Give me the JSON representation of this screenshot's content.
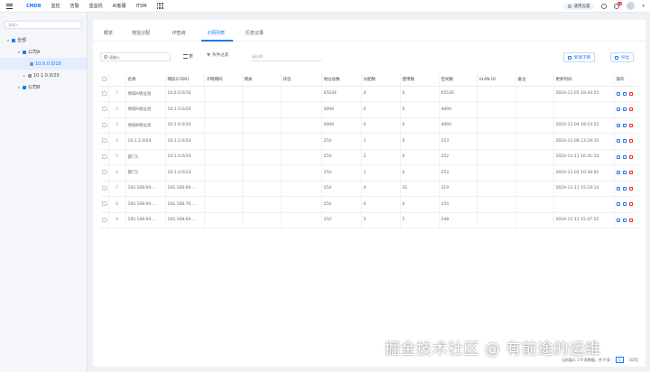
{
  "topnav": {
    "items": [
      "CMDB",
      "监控",
      "告警",
      "堡垒机",
      "AI客服",
      "ITSM"
    ],
    "active_index": 0,
    "help_label": "通用设置",
    "badge_count": "99"
  },
  "sidebar": {
    "search_placeholder": "请输入",
    "tree": [
      {
        "label": "全部",
        "level": 0
      },
      {
        "label": "公司A",
        "level": 1
      },
      {
        "label": "10.0.0.0/16",
        "level": 2,
        "selected": true
      },
      {
        "label": "10.1.0.0/20",
        "level": 2
      },
      {
        "label": "公司B",
        "level": 1
      }
    ]
  },
  "tabs": [
    "概览",
    "地址分配",
    "IP查询",
    "子网列表",
    "历史记录"
  ],
  "active_tab": 3,
  "toolbar": {
    "search_placeholder": "请输入",
    "view_label": "表",
    "filter_label": "条件过滤",
    "filter_placeholder": "请选择",
    "create_label": "新建子网",
    "export_label": "导出"
  },
  "table": {
    "columns": [
      "",
      "",
      "名称",
      "网段(CIDR)",
      "子网掩码",
      "网关",
      "状态",
      "地址总数",
      "分配数",
      "使用数",
      "空闲数",
      "VLAN ID",
      "备注",
      "更新时间",
      "操作"
    ],
    "rows": [
      [
        "1",
        "地域A地址池",
        "10.0.0.0/16",
        "",
        "",
        "",
        "65534",
        "4",
        "0",
        "65530",
        "",
        "",
        "2024-11-05 18:44:55"
      ],
      [
        "2",
        "地域A地址池",
        "10.1.0.0/20",
        "",
        "",
        "",
        "4094",
        "0",
        "0",
        "4094",
        "",
        "",
        ""
      ],
      [
        "3",
        "地域B地址池",
        "10.2.0.0/20",
        "",
        "",
        "",
        "4094",
        "0",
        "0",
        "4094",
        "",
        "",
        "2024-11-04 18:14:25"
      ],
      [
        "4",
        "10.1.2.0/24",
        "10.1.2.0/24",
        "",
        "",
        "",
        "254",
        "1",
        "0",
        "253",
        "",
        "",
        "2024-11-08 13:29:10"
      ],
      [
        "5",
        "部门1",
        "10.1.0.0/24",
        "",
        "",
        "",
        "254",
        "2",
        "0",
        "252",
        "",
        "",
        "2024-11-11 16:41:14"
      ],
      [
        "6",
        "部门1",
        "10.1.0.0/24",
        "",
        "",
        "",
        "254",
        "1",
        "0",
        "253",
        "",
        "",
        "2024-11-05 10:36:02"
      ],
      [
        "7",
        "192.168.69....",
        "192.168.69....",
        "",
        "",
        "",
        "254",
        "4",
        "31",
        "219",
        "",
        "",
        "2024-11-11 15:24:14"
      ],
      [
        "8",
        "192.168.69....",
        "192.168.70....",
        "",
        "",
        "",
        "254",
        "0",
        "0",
        "254",
        "",
        "",
        ""
      ],
      [
        "9",
        "192.168.69....",
        "192.168.69....",
        "",
        "",
        "",
        "254",
        "2",
        "5",
        "248",
        "",
        "",
        "2024-11-11 15:47:52"
      ]
    ]
  },
  "footer": {
    "summary": "当前展示 1-9 条数据，共 9 条",
    "page": "1",
    "page_size": "10/页"
  },
  "watermark": "掘金技术社区 @ 有前途的运维",
  "colors": {
    "accent": "#1677ff",
    "danger": "#f5222d"
  }
}
